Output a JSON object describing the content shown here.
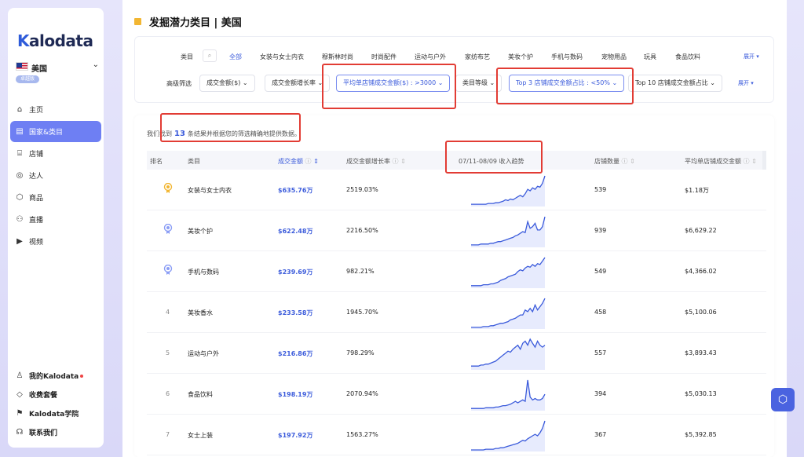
{
  "brand": {
    "logo_k": "K",
    "logo_rest": "alodata"
  },
  "sidebar": {
    "region": "美国",
    "plan": "卓越版",
    "items": [
      {
        "label": "主页",
        "icon": "home-icon"
      },
      {
        "label": "国家&类目",
        "icon": "category-icon",
        "active": true
      },
      {
        "label": "店铺",
        "icon": "shop-icon"
      },
      {
        "label": "达人",
        "icon": "creator-icon"
      },
      {
        "label": "商品",
        "icon": "product-icon"
      },
      {
        "label": "直播",
        "icon": "live-icon"
      },
      {
        "label": "视频",
        "icon": "video-icon"
      }
    ],
    "bottom_items": [
      {
        "label": "我的Kalodata",
        "icon": "user-icon"
      },
      {
        "label": "收费套餐",
        "icon": "diamond-icon"
      },
      {
        "label": "Kalodata学院",
        "icon": "academy-icon"
      },
      {
        "label": "联系我们",
        "icon": "headset-icon"
      }
    ]
  },
  "main": {
    "title": "发掘潜力类目 | 美国",
    "filters": {
      "category_label": "类目",
      "categories": [
        "全部",
        "女装与女士内衣",
        "穆斯林时尚",
        "时尚配件",
        "运动与户外",
        "家纺布艺",
        "美妆个护",
        "手机与数码",
        "宠物用品",
        "玩具",
        "食品饮料"
      ],
      "expand": "展开",
      "advanced_label": "高级筛选",
      "dropdowns": [
        "成交金额($)",
        "成交金额增长率",
        "平均单店铺成交金额($) : >3000",
        "类目等级",
        "Top 3 店铺成交金额占比 : <50%",
        "Top 10 店铺成交金额占比"
      ]
    },
    "results": {
      "prefix": "我们找到",
      "count": "13",
      "suffix": "条结果并根据您的筛选精确地提供数据。"
    },
    "table": {
      "headers": [
        "排名",
        "类目",
        "成交金额",
        "成交金额增长率",
        "07/11-08/09 收入趋势",
        "店铺数量",
        "平均单店铺成交金额"
      ],
      "rows": [
        {
          "rank": "1",
          "category": "女装与女士内衣",
          "gmv": "$635.76万",
          "growth": "2519.03%",
          "shops": "539",
          "avg": "$1.18万",
          "trend": [
            2,
            2,
            2,
            2,
            2,
            2,
            2,
            3,
            3,
            3,
            4,
            4,
            5,
            6,
            8,
            7,
            9,
            8,
            10,
            12,
            14,
            12,
            16,
            22,
            20,
            24,
            22,
            26,
            25,
            30,
            40
          ]
        },
        {
          "rank": "2",
          "category": "美妆个护",
          "gmv": "$622.48万",
          "growth": "2216.50%",
          "shops": "939",
          "avg": "$6,629.22",
          "trend": [
            2,
            2,
            2,
            2,
            3,
            3,
            3,
            3,
            4,
            4,
            5,
            6,
            6,
            7,
            8,
            9,
            10,
            11,
            13,
            14,
            16,
            18,
            17,
            30,
            22,
            24,
            28,
            20,
            20,
            24,
            36
          ]
        },
        {
          "rank": "3",
          "category": "手机与数码",
          "gmv": "$239.69万",
          "growth": "982.21%",
          "shops": "549",
          "avg": "$4,366.02",
          "trend": [
            2,
            2,
            2,
            2,
            2,
            3,
            3,
            3,
            4,
            4,
            5,
            6,
            8,
            9,
            10,
            12,
            13,
            14,
            15,
            18,
            20,
            19,
            22,
            24,
            23,
            26,
            24,
            27,
            26,
            30,
            34
          ]
        },
        {
          "rank": "4",
          "category": "美妆香水",
          "gmv": "$233.58万",
          "growth": "1945.70%",
          "shops": "458",
          "avg": "$5,100.06",
          "trend": [
            1,
            1,
            1,
            1,
            1,
            2,
            2,
            2,
            3,
            3,
            4,
            5,
            6,
            6,
            7,
            8,
            10,
            11,
            12,
            14,
            16,
            16,
            22,
            20,
            24,
            20,
            28,
            22,
            26,
            30,
            36
          ]
        },
        {
          "rank": "5",
          "category": "运动与户外",
          "gmv": "$216.86万",
          "growth": "798.29%",
          "shops": "557",
          "avg": "$3,893.43",
          "trend": [
            3,
            3,
            3,
            3,
            4,
            4,
            5,
            5,
            6,
            7,
            8,
            10,
            12,
            14,
            16,
            18,
            17,
            20,
            22,
            24,
            20,
            26,
            28,
            24,
            30,
            26,
            22,
            28,
            24,
            22,
            24
          ]
        },
        {
          "rank": "6",
          "category": "食品饮料",
          "gmv": "$198.19万",
          "growth": "2070.94%",
          "shops": "394",
          "avg": "$5,030.13",
          "trend": [
            2,
            2,
            2,
            2,
            2,
            2,
            3,
            3,
            3,
            3,
            4,
            4,
            5,
            6,
            6,
            7,
            8,
            10,
            12,
            10,
            12,
            14,
            12,
            42,
            18,
            14,
            16,
            14,
            14,
            16,
            22
          ]
        },
        {
          "rank": "7",
          "category": "女士上装",
          "gmv": "$197.92万",
          "growth": "1563.27%",
          "shops": "367",
          "avg": "$5,392.85",
          "trend": [
            1,
            1,
            1,
            1,
            1,
            1,
            2,
            2,
            2,
            2,
            3,
            3,
            4,
            4,
            5,
            6,
            7,
            8,
            9,
            10,
            12,
            14,
            13,
            16,
            18,
            20,
            22,
            20,
            24,
            30,
            40
          ]
        }
      ]
    }
  },
  "colors": {
    "accent": "#3b5bdb",
    "highlight": "#e23c34",
    "active_nav": "#6e7ff3"
  }
}
